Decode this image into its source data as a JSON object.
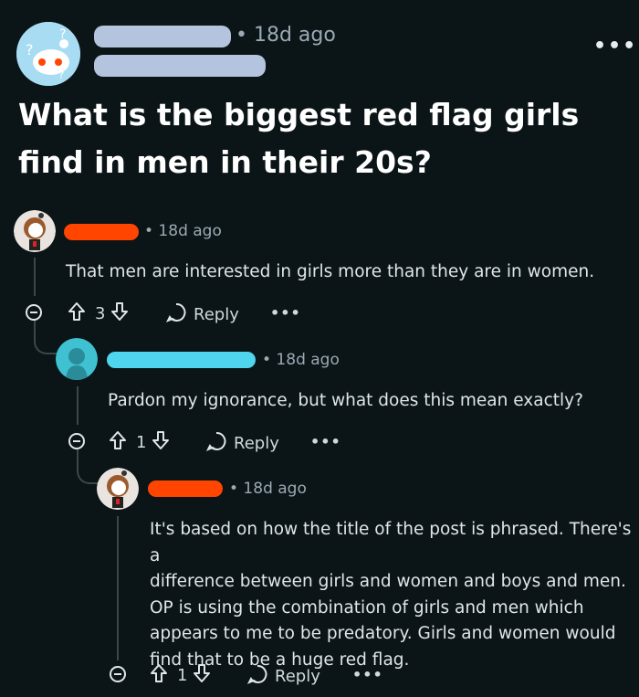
{
  "post": {
    "time": "• 18d ago",
    "more_label": "•••",
    "title": "What is the biggest red flag girls find in men in their 20s?",
    "redacted_color": "#b4c4de"
  },
  "comments": [
    {
      "time": "• 18d ago",
      "text": "That men are interested in girls more than they are in women.",
      "votes": "3",
      "reply_label": "Reply",
      "more_label": "•••",
      "name_color": "#ff4500"
    },
    {
      "time": "• 18d ago",
      "text": "Pardon my ignorance, but what does this mean exactly?",
      "votes": "1",
      "reply_label": "Reply",
      "more_label": "•••",
      "name_color": "#4fd6ee"
    },
    {
      "time": "• 18d ago",
      "text_lines": [
        "It's based on how the title of the post is phrased. There's a",
        "difference between girls and women and boys and men.",
        "OP is using the combination of girls and men which",
        "appears to me to be predatory. Girls and women would",
        "find that to be a huge red flag."
      ],
      "votes": "1",
      "reply_label": "Reply",
      "more_label": "•••",
      "name_color": "#ff4500"
    }
  ],
  "icons": [
    "reddit-question-avatar-icon",
    "reddit-snoo-avatar-icon",
    "upvote-arrow-icon",
    "downvote-arrow-icon",
    "reply-bubble-icon",
    "collapse-minus-icon"
  ]
}
